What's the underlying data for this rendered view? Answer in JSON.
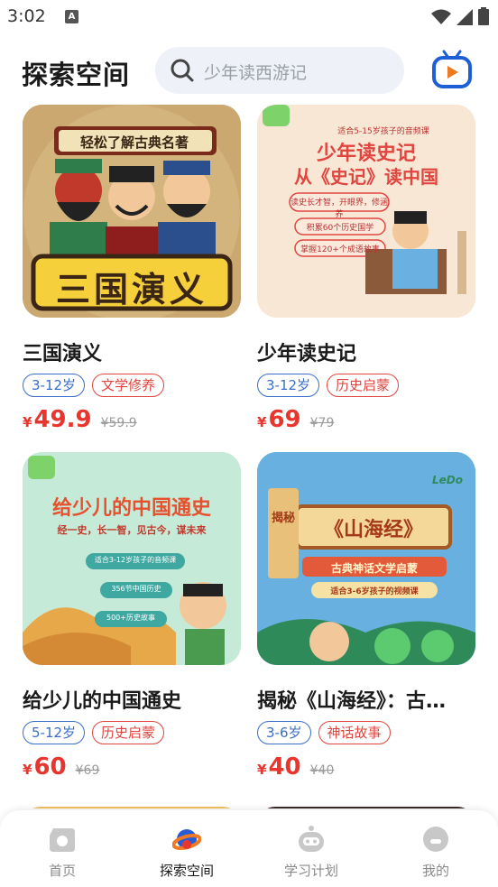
{
  "status": {
    "time": "3:02"
  },
  "header": {
    "title": "探索空间",
    "search_placeholder": "少年读西游记"
  },
  "courses": [
    {
      "image_caption": "三国演义",
      "title": "三国演义",
      "age": "3-12岁",
      "category": "文学修养",
      "currency": "¥",
      "price": "49.9",
      "old_price": "¥59.9"
    },
    {
      "image_caption": "少年读史记",
      "title": "少年读史记",
      "age": "3-12岁",
      "category": "历史启蒙",
      "currency": "¥",
      "price": "69",
      "old_price": "¥79"
    },
    {
      "image_caption": "给少儿的中国通史",
      "title": "给少儿的中国通史",
      "age": "5-12岁",
      "category": "历史启蒙",
      "currency": "¥",
      "price": "60",
      "old_price": "¥69"
    },
    {
      "image_caption": "《山海经》",
      "title": "揭秘《山海经》：古…",
      "age": "3-6岁",
      "category": "神话故事",
      "currency": "¥",
      "price": "40",
      "old_price": "¥40"
    }
  ],
  "image_texts": {
    "sanguo_banner": "轻松了解古典名著",
    "shiji_tags": "读史长才智，开眼界，修涵养",
    "shiji_line1": "从《史记》读中国",
    "shiji_info1": "适合5-15岁孩子的音频课",
    "shiji_info2": "积累60个历史国学",
    "shiji_info3": "掌握120+个成语故事",
    "tongshi_sub": "经一史，长一智，见古今，谋未来",
    "tongshi_info1": "适合3-12岁孩子的音频课",
    "tongshi_info2": "356节中国历史",
    "tongshi_info3": "500+历史故事",
    "shanhai_sub": "古典神话文学启蒙",
    "shanhai_info": "适合3-6岁孩子的视频课",
    "shanhai_side": "揭秘",
    "shanhai_logo": "LeDo"
  },
  "tabs": [
    {
      "label": "首页",
      "icon": "home-icon",
      "active": false
    },
    {
      "label": "探索空间",
      "icon": "planet-icon",
      "active": true
    },
    {
      "label": "学习计划",
      "icon": "robot-icon",
      "active": false
    },
    {
      "label": "我的",
      "icon": "profile-icon",
      "active": false
    }
  ],
  "colors": {
    "price": "#e8352e",
    "tag_age": "#3b6ec9",
    "tag_category": "#e0463f",
    "search_bg": "#eef1f7",
    "brand_blue": "#1f5fd6",
    "brand_orange": "#f07a23"
  }
}
